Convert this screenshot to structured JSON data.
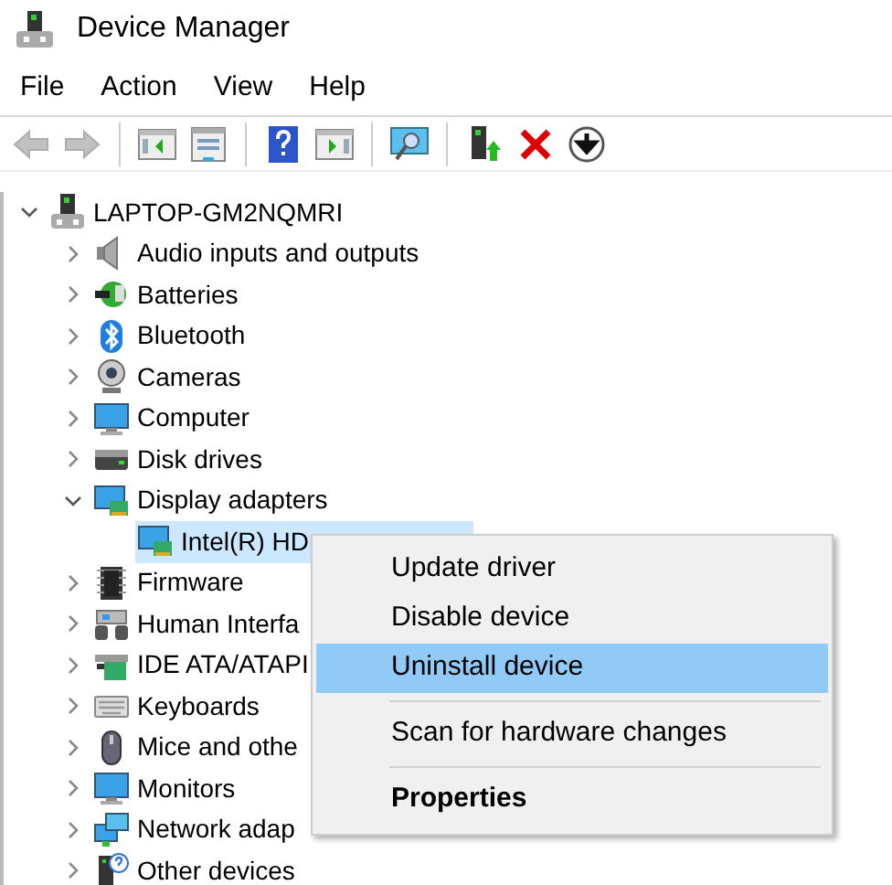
{
  "window": {
    "title": "Device Manager"
  },
  "menu_bar": [
    "File",
    "Action",
    "View",
    "Help"
  ],
  "toolbar": [
    {
      "disabled": true
    },
    {
      "disabled": true
    },
    {
      "disabled": false
    },
    {
      "disabled": false
    },
    {
      "disabled": false
    },
    {
      "disabled": false
    },
    {
      "disabled": false
    },
    {
      "disabled": false
    },
    {
      "disabled": false
    },
    {
      "disabled": false
    }
  ],
  "tree": {
    "label": "LAPTOP-GM2NQMRI",
    "expanded": true,
    "children": [
      {
        "label": "Audio inputs and outputs",
        "expanded": false
      },
      {
        "label": "Batteries",
        "expanded": false
      },
      {
        "label": "Bluetooth",
        "expanded": false
      },
      {
        "label": "Cameras",
        "expanded": false
      },
      {
        "label": "Computer",
        "expanded": false
      },
      {
        "label": "Disk drives",
        "expanded": false
      },
      {
        "label": "Display adapters",
        "expanded": true,
        "children": [
          {
            "label": "Intel(R) HD",
            "selected": true
          }
        ]
      },
      {
        "label": "Firmware",
        "expanded": false
      },
      {
        "label": "Human Interfa",
        "expanded": false
      },
      {
        "label": "IDE ATA/ATAPI",
        "expanded": false
      },
      {
        "label": "Keyboards",
        "expanded": false
      },
      {
        "label": "Mice and othe",
        "expanded": false
      },
      {
        "label": "Monitors",
        "expanded": false
      },
      {
        "label": "Network adap",
        "expanded": false
      },
      {
        "label": "Other devices",
        "expanded": false
      }
    ]
  },
  "context_menu": [
    {
      "label": "Update driver",
      "selected": false,
      "default": false
    },
    {
      "label": "Disable device",
      "selected": false,
      "default": false
    },
    {
      "label": "Uninstall device",
      "selected": true,
      "default": false,
      "separator_after": true
    },
    {
      "label": "Scan for hardware changes",
      "selected": false,
      "default": false,
      "separator_after": true
    },
    {
      "label": "Properties",
      "selected": false,
      "default": true
    }
  ]
}
